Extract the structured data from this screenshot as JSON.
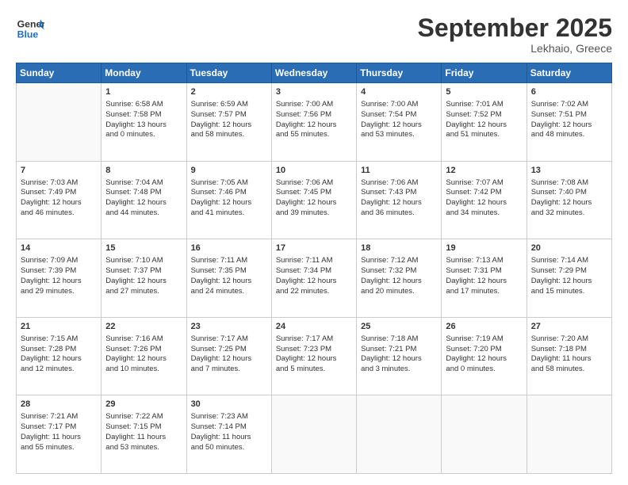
{
  "header": {
    "logo_line1": "General",
    "logo_line2": "Blue",
    "month": "September 2025",
    "location": "Lekhaio, Greece"
  },
  "days_of_week": [
    "Sunday",
    "Monday",
    "Tuesday",
    "Wednesday",
    "Thursday",
    "Friday",
    "Saturday"
  ],
  "weeks": [
    [
      {
        "day": "",
        "info": ""
      },
      {
        "day": "1",
        "info": "Sunrise: 6:58 AM\nSunset: 7:58 PM\nDaylight: 13 hours\nand 0 minutes."
      },
      {
        "day": "2",
        "info": "Sunrise: 6:59 AM\nSunset: 7:57 PM\nDaylight: 12 hours\nand 58 minutes."
      },
      {
        "day": "3",
        "info": "Sunrise: 7:00 AM\nSunset: 7:56 PM\nDaylight: 12 hours\nand 55 minutes."
      },
      {
        "day": "4",
        "info": "Sunrise: 7:00 AM\nSunset: 7:54 PM\nDaylight: 12 hours\nand 53 minutes."
      },
      {
        "day": "5",
        "info": "Sunrise: 7:01 AM\nSunset: 7:52 PM\nDaylight: 12 hours\nand 51 minutes."
      },
      {
        "day": "6",
        "info": "Sunrise: 7:02 AM\nSunset: 7:51 PM\nDaylight: 12 hours\nand 48 minutes."
      }
    ],
    [
      {
        "day": "7",
        "info": "Sunrise: 7:03 AM\nSunset: 7:49 PM\nDaylight: 12 hours\nand 46 minutes."
      },
      {
        "day": "8",
        "info": "Sunrise: 7:04 AM\nSunset: 7:48 PM\nDaylight: 12 hours\nand 44 minutes."
      },
      {
        "day": "9",
        "info": "Sunrise: 7:05 AM\nSunset: 7:46 PM\nDaylight: 12 hours\nand 41 minutes."
      },
      {
        "day": "10",
        "info": "Sunrise: 7:06 AM\nSunset: 7:45 PM\nDaylight: 12 hours\nand 39 minutes."
      },
      {
        "day": "11",
        "info": "Sunrise: 7:06 AM\nSunset: 7:43 PM\nDaylight: 12 hours\nand 36 minutes."
      },
      {
        "day": "12",
        "info": "Sunrise: 7:07 AM\nSunset: 7:42 PM\nDaylight: 12 hours\nand 34 minutes."
      },
      {
        "day": "13",
        "info": "Sunrise: 7:08 AM\nSunset: 7:40 PM\nDaylight: 12 hours\nand 32 minutes."
      }
    ],
    [
      {
        "day": "14",
        "info": "Sunrise: 7:09 AM\nSunset: 7:39 PM\nDaylight: 12 hours\nand 29 minutes."
      },
      {
        "day": "15",
        "info": "Sunrise: 7:10 AM\nSunset: 7:37 PM\nDaylight: 12 hours\nand 27 minutes."
      },
      {
        "day": "16",
        "info": "Sunrise: 7:11 AM\nSunset: 7:35 PM\nDaylight: 12 hours\nand 24 minutes."
      },
      {
        "day": "17",
        "info": "Sunrise: 7:11 AM\nSunset: 7:34 PM\nDaylight: 12 hours\nand 22 minutes."
      },
      {
        "day": "18",
        "info": "Sunrise: 7:12 AM\nSunset: 7:32 PM\nDaylight: 12 hours\nand 20 minutes."
      },
      {
        "day": "19",
        "info": "Sunrise: 7:13 AM\nSunset: 7:31 PM\nDaylight: 12 hours\nand 17 minutes."
      },
      {
        "day": "20",
        "info": "Sunrise: 7:14 AM\nSunset: 7:29 PM\nDaylight: 12 hours\nand 15 minutes."
      }
    ],
    [
      {
        "day": "21",
        "info": "Sunrise: 7:15 AM\nSunset: 7:28 PM\nDaylight: 12 hours\nand 12 minutes."
      },
      {
        "day": "22",
        "info": "Sunrise: 7:16 AM\nSunset: 7:26 PM\nDaylight: 12 hours\nand 10 minutes."
      },
      {
        "day": "23",
        "info": "Sunrise: 7:17 AM\nSunset: 7:25 PM\nDaylight: 12 hours\nand 7 minutes."
      },
      {
        "day": "24",
        "info": "Sunrise: 7:17 AM\nSunset: 7:23 PM\nDaylight: 12 hours\nand 5 minutes."
      },
      {
        "day": "25",
        "info": "Sunrise: 7:18 AM\nSunset: 7:21 PM\nDaylight: 12 hours\nand 3 minutes."
      },
      {
        "day": "26",
        "info": "Sunrise: 7:19 AM\nSunset: 7:20 PM\nDaylight: 12 hours\nand 0 minutes."
      },
      {
        "day": "27",
        "info": "Sunrise: 7:20 AM\nSunset: 7:18 PM\nDaylight: 11 hours\nand 58 minutes."
      }
    ],
    [
      {
        "day": "28",
        "info": "Sunrise: 7:21 AM\nSunset: 7:17 PM\nDaylight: 11 hours\nand 55 minutes."
      },
      {
        "day": "29",
        "info": "Sunrise: 7:22 AM\nSunset: 7:15 PM\nDaylight: 11 hours\nand 53 minutes."
      },
      {
        "day": "30",
        "info": "Sunrise: 7:23 AM\nSunset: 7:14 PM\nDaylight: 11 hours\nand 50 minutes."
      },
      {
        "day": "",
        "info": ""
      },
      {
        "day": "",
        "info": ""
      },
      {
        "day": "",
        "info": ""
      },
      {
        "day": "",
        "info": ""
      }
    ]
  ]
}
